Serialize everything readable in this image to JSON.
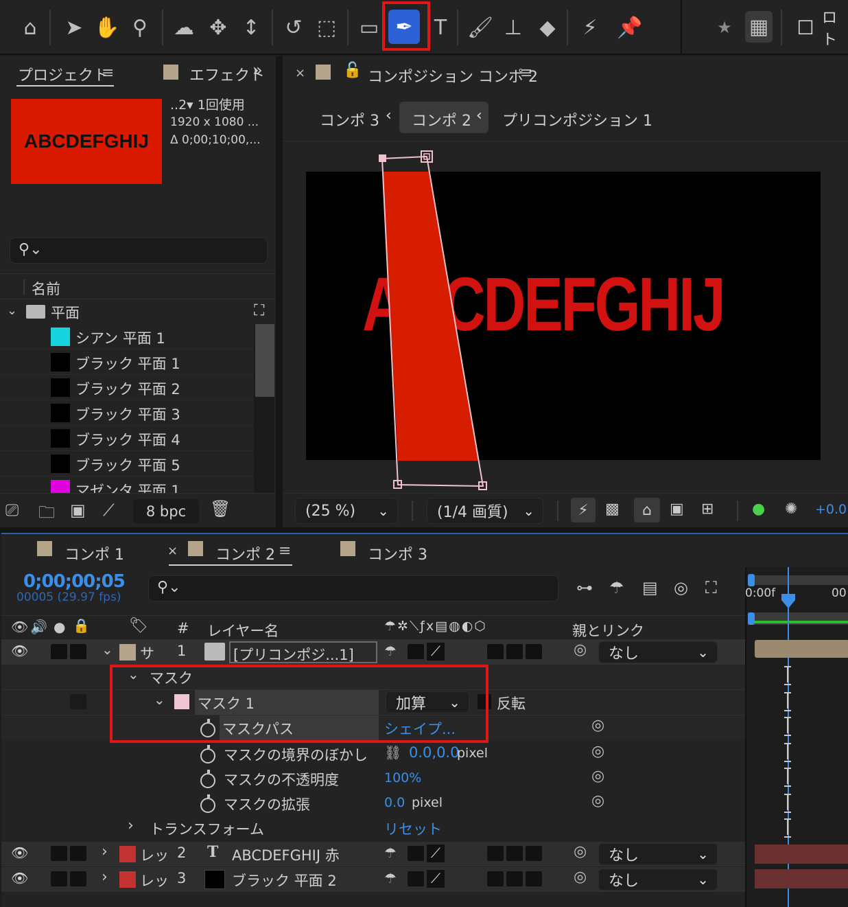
{
  "toolbar": {
    "workspace_label": "ロト"
  },
  "project_panel": {
    "tab_project": "プロジェクト",
    "tab_effects": "エフェクト",
    "thumbnail_text": "ABCDEFGHIJ",
    "comp_usage": "..2▾  1回使用",
    "comp_size": "1920 x 1080 ...",
    "comp_duration": "Δ 0;00;10;00,...",
    "column_name": "名前",
    "folder_name": "平面",
    "items": [
      {
        "name": "シアン 平面 1",
        "color": "#17d3dd"
      },
      {
        "name": "ブラック 平面 1",
        "color": "#000000"
      },
      {
        "name": "ブラック 平面 2",
        "color": "#000000"
      },
      {
        "name": "ブラック 平面 3",
        "color": "#000000"
      },
      {
        "name": "ブラック 平面 4",
        "color": "#000000"
      },
      {
        "name": "ブラック 平面 5",
        "color": "#000000"
      },
      {
        "name": "マゼンタ 平面 1",
        "color": "#e000e0"
      }
    ],
    "bpc_label": "8 bpc"
  },
  "comp_panel": {
    "title": "コンポジション コンポ 2",
    "breadcrumbs": [
      "コンポ 3",
      "コンポ 2",
      "プリコンポジション 1"
    ],
    "canvas_text": "ABCDEFGHIJ",
    "zoom": "(25 %)",
    "resolution": "(1/4 画質)",
    "exposure": "+0.0"
  },
  "timeline": {
    "tabs": [
      "コンポ 1",
      "コンポ 2",
      "コンポ 3"
    ],
    "timecode": "0;00;00;05",
    "frame_info": "00005 (29.97 fps)",
    "col_hash": "#",
    "col_layer_name": "レイヤー名",
    "col_parent": "親とリンク",
    "ruler_start": "0:00f",
    "ruler_end": "00",
    "layers": [
      {
        "label": "サ",
        "num": "1",
        "name": "[プリコンポジ...1]",
        "parent": "なし",
        "color": "#b3a48a"
      },
      {
        "label": "レッ",
        "num": "2",
        "name": "ABCDEFGHIJ 赤",
        "parent": "なし",
        "color": "#c33333"
      },
      {
        "label": "レッ",
        "num": "3",
        "name": "ブラック 平面 2",
        "parent": "なし",
        "color": "#c33333"
      }
    ],
    "mask_group": "マスク",
    "mask_name": "マスク 1",
    "mask_mode": "加算",
    "mask_invert": "反転",
    "mask_path_label": "マスクパス",
    "mask_path_value": "シェイプ...",
    "feather_label": "マスクの境界のぼかし",
    "feather_value": "0.0,0.0",
    "feather_unit": "pixel",
    "opacity_label": "マスクの不透明度",
    "opacity_value": "100%",
    "expansion_label": "マスクの拡張",
    "expansion_value": "0.0",
    "expansion_unit": "pixel",
    "transform_label": "トランスフォーム",
    "transform_value": "リセット"
  }
}
